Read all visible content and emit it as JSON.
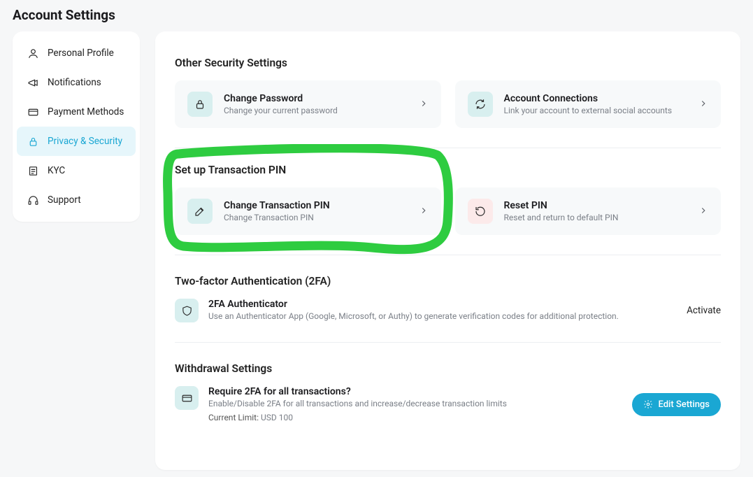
{
  "page_title": "Account Settings",
  "sidebar": {
    "items": [
      {
        "label": "Personal Profile"
      },
      {
        "label": "Notifications"
      },
      {
        "label": "Payment Methods"
      },
      {
        "label": "Privacy & Security"
      },
      {
        "label": "KYC"
      },
      {
        "label": "Support"
      }
    ]
  },
  "sections": {
    "other_security": {
      "title": "Other Security Settings",
      "change_password": {
        "title": "Change Password",
        "sub": "Change your current password"
      },
      "account_connections": {
        "title": "Account Connections",
        "sub": "Link your account to external social accounts"
      }
    },
    "txn_pin": {
      "title": "Set up Transaction PIN",
      "change_pin": {
        "title": "Change Transaction PIN",
        "sub": "Change Transaction PIN"
      },
      "reset_pin": {
        "title": "Reset PIN",
        "sub": "Reset and return to default PIN"
      }
    },
    "twofa": {
      "title": "Two-factor Authentication (2FA)",
      "auth": {
        "title": "2FA Authenticator",
        "sub": "Use an Authenticator App (Google, Microsoft, or Authy) to generate verification codes for additional protection."
      },
      "activate_label": "Activate"
    },
    "withdrawal": {
      "title": "Withdrawal Settings",
      "row": {
        "title": "Require 2FA for all transactions?",
        "sub": "Enable/Disable 2FA for all transactions and increase/decrease transaction limits",
        "limit_label": "Current Limit: ",
        "limit_value": "USD 100"
      },
      "edit_label": "Edit Settings"
    }
  },
  "highlight_color": "#2ecc40"
}
